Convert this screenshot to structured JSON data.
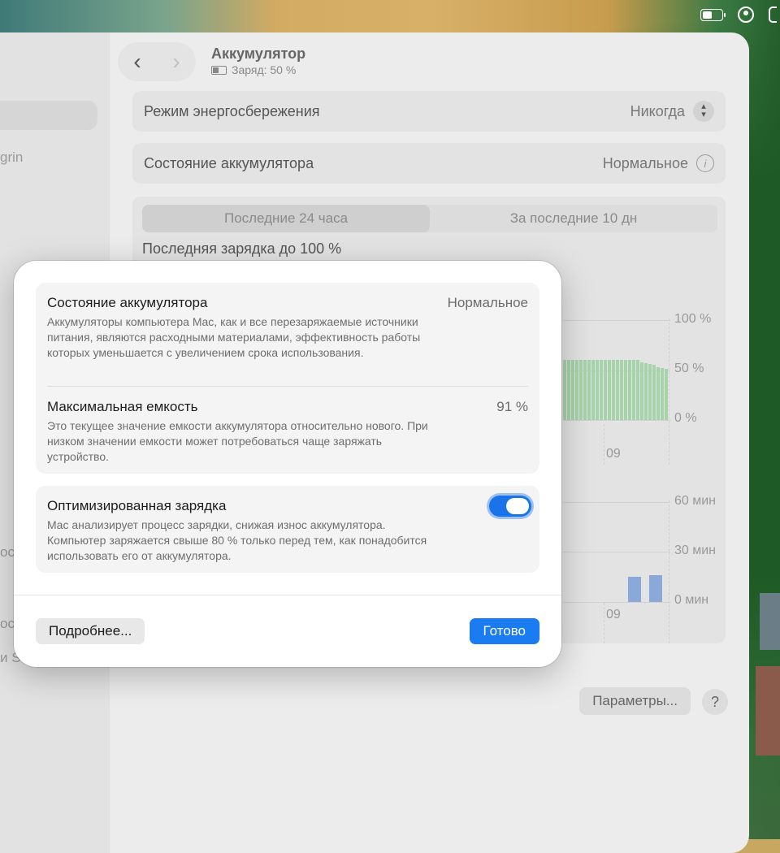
{
  "window": {
    "title": "Аккумулятор",
    "subtitle": "Заряд: 50 %",
    "sidebar_fragments": [
      "grin",
      "oc",
      "oc",
      "и S"
    ]
  },
  "settings": {
    "power_saving_label": "Режим энергосбережения",
    "power_saving_value": "Никогда",
    "battery_health_label": "Состояние аккумулятора",
    "battery_health_value": "Нормальное"
  },
  "history": {
    "tabs": [
      "Последние 24 часа",
      "За последние 10 дн"
    ],
    "active_tab": 0,
    "last_charge": "Последняя зарядка до 100 %",
    "level_ticks": [
      "100 %",
      "50 %",
      "0 %"
    ],
    "usage_ticks": [
      "60 мин",
      "30 мин",
      "0 мин"
    ],
    "hour_label": "09",
    "params_button": "Параметры...",
    "help_button": "?"
  },
  "chart_data": [
    {
      "type": "bar",
      "title": "",
      "ylabel": "",
      "ylim": [
        0,
        100
      ],
      "yticks": [
        "0 %",
        "50 %",
        "100 %"
      ],
      "xticks": [
        "09"
      ],
      "colors": [
        "#a6d3aa"
      ],
      "values": [
        60,
        60,
        60,
        60,
        60,
        60,
        60,
        60,
        60,
        60,
        60,
        60,
        60,
        60,
        60,
        60,
        60,
        60,
        60,
        58,
        57,
        56,
        55,
        53,
        52,
        51
      ]
    },
    {
      "type": "bar",
      "title": "",
      "ylabel": "",
      "ylim": [
        0,
        60
      ],
      "yticks": [
        "0 мин",
        "30 мин",
        "60 мин"
      ],
      "xticks": [
        "09"
      ],
      "colors": [
        "#8aa8d8"
      ],
      "values": [
        15,
        16
      ]
    }
  ],
  "dialog": {
    "health_title": "Состояние аккумулятора",
    "health_value": "Нормальное",
    "health_desc": "Аккумуляторы компьютера Mac, как и все перезаряжаемые источники питания, являются расходными материалами, эффективность работы которых уменьшается с увеличением срока использования.",
    "capacity_title": "Максимальная емкость",
    "capacity_value": "91 %",
    "capacity_desc": "Это текущее значение емкости аккумулятора относительно нового. При низком значении емкости может потребоваться чаще заряжать устройство.",
    "optimized_title": "Оптимизированная зарядка",
    "optimized_desc": "Mac анализирует процесс зарядки, снижая износ аккумулятора. Компьютер заряжается свыше 80 % только перед тем, как понадобится использовать его от аккумулятора.",
    "optimized_enabled": true,
    "more_button": "Подробнее...",
    "done_button": "Готово"
  }
}
